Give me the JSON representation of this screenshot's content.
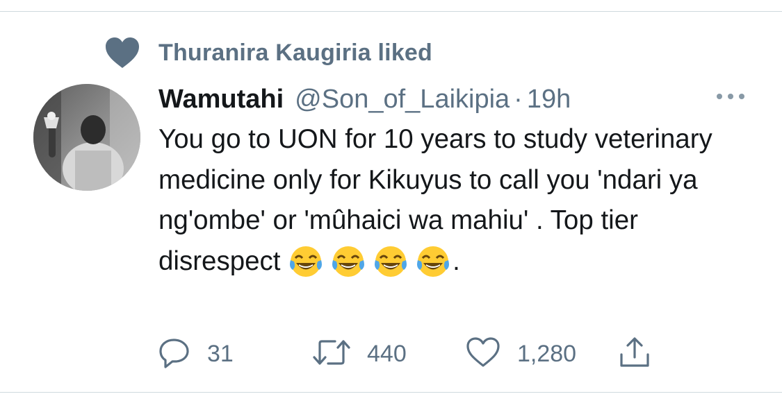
{
  "context": {
    "liked_by_text": "Thuranira Kaugiria liked",
    "icon": "heart-filled-icon"
  },
  "tweet": {
    "author_name": "Wamutahi",
    "author_handle": "@Son_of_Laikipia",
    "separator": "·",
    "timestamp": "19h",
    "text_main": "You go to UON for 10 years to study veterinary medicine only for Kikuyus to call you 'ndari ya ng'ombe' or 'mûhaici wa mahiu' . Top tier disrespect ",
    "text_end": ".",
    "emoji": "face-with-tears-of-joy",
    "emoji_count": 4
  },
  "actions": {
    "reply_count": "31",
    "retweet_count": "440",
    "like_count": "1,280"
  },
  "colors": {
    "secondary_text": "#5b7083",
    "primary_text": "#14171a",
    "divider": "#cfd9de"
  }
}
